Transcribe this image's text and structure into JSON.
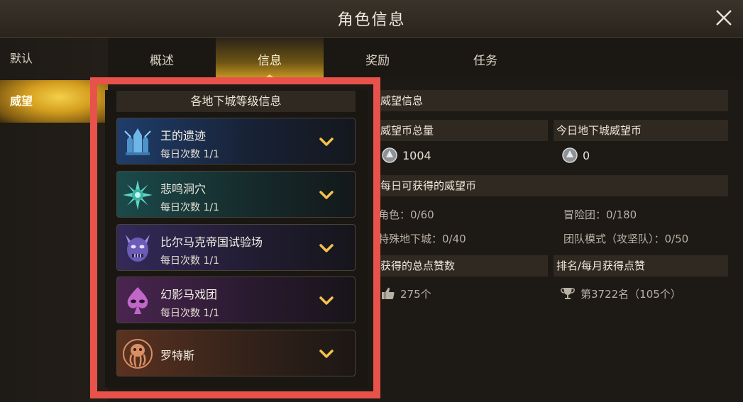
{
  "window": {
    "title": "角色信息"
  },
  "side_tabs": [
    {
      "label": "默认",
      "active": false
    },
    {
      "label": "威望",
      "active": true
    }
  ],
  "top_tabs": [
    {
      "label": "概述",
      "active": false
    },
    {
      "label": "信息",
      "active": true
    },
    {
      "label": "奖励",
      "active": false
    },
    {
      "label": "任务",
      "active": false
    }
  ],
  "dungeon_panel": {
    "header": "各地下城等级信息",
    "items": [
      {
        "name": "王的遗迹",
        "count": "每日次数 1/1",
        "icon": "crystal-ruins-icon",
        "color": "#1f3d6b"
      },
      {
        "name": "悲鸣洞穴",
        "count": "每日次数 1/1",
        "icon": "teal-flower-icon",
        "color": "#1b4a4a"
      },
      {
        "name": "比尔马克帝国试验场",
        "count": "每日次数 1/1",
        "icon": "purple-beast-icon",
        "color": "#332a5a"
      },
      {
        "name": "幻影马戏团",
        "count": "每日次数 1/1",
        "icon": "spade-mask-icon",
        "color": "#4a2550"
      },
      {
        "name": "罗特斯",
        "count": "",
        "icon": "octopus-icon",
        "color": "#5a3220"
      }
    ]
  },
  "prestige": {
    "header": "威望信息",
    "total_label": "威望币总量",
    "total_value": "1004",
    "today_label": "今日地下城威望币",
    "today_value": "0",
    "daily_header": "每日可获得的威望币",
    "role": "角色：0/60",
    "adventure": "冒险团：0/180",
    "special": "特殊地下城：0/40",
    "raid": "团队模式（攻坚队）：0/50",
    "likes_header": "获得的总点赞数",
    "likes_value": "275个",
    "rank_header": "排名/每月获得点赞",
    "rank_value": "第3722名（105个）"
  },
  "colors": {
    "highlight": "#e8524b",
    "accent_gold": "#d8a93a",
    "chevron": "#f4c24a"
  }
}
